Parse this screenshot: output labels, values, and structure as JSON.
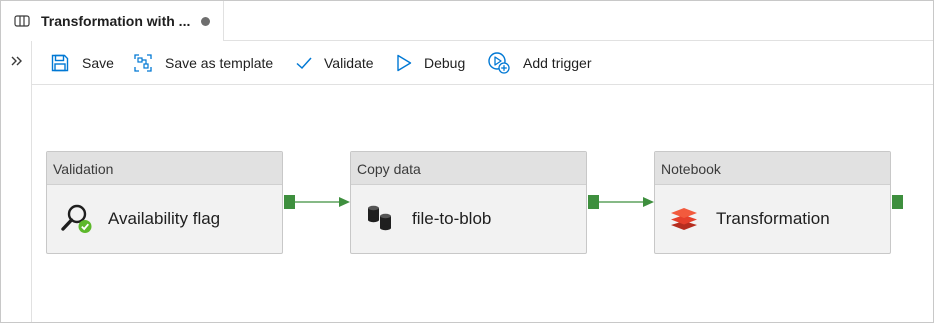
{
  "tab": {
    "title": "Transformation with ...",
    "unsaved_indicator": "dot",
    "icon": "pipeline-icon"
  },
  "rail": {
    "toggle_icon": "double-chevron-right-icon"
  },
  "toolbar": {
    "save_label": "Save",
    "save_template_label": "Save as template",
    "validate_label": "Validate",
    "debug_label": "Debug",
    "add_trigger_label": "Add trigger",
    "icon_color": "#0078d4"
  },
  "activities": [
    {
      "type": "Validation",
      "name": "Availability flag",
      "icon": "magnifier-check-icon"
    },
    {
      "type": "Copy data",
      "name": "file-to-blob",
      "icon": "database-cylinders-icon"
    },
    {
      "type": "Notebook",
      "name": "Transformation",
      "icon": "layers-stack-icon"
    }
  ],
  "colors": {
    "success_port": "#3e8f3e",
    "header_bg": "#e1e1e1",
    "body_bg": "#f2f2f2",
    "notebook_icon": "#e53f2b"
  }
}
